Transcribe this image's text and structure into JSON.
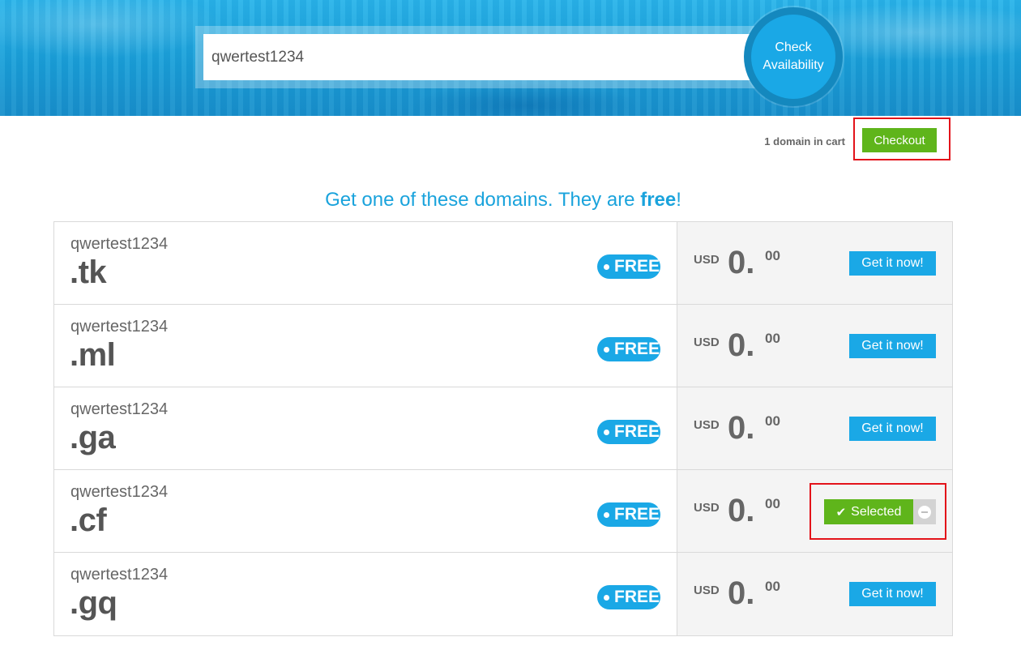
{
  "search": {
    "value": "qwertest1234",
    "button_line1": "Check",
    "button_line2": "Availability"
  },
  "cart": {
    "count_text": "1 domain in cart",
    "checkout_label": "Checkout"
  },
  "heading": {
    "prefix": "Get one of these domains. They are ",
    "emphasis": "free",
    "suffix": "!"
  },
  "domains": [
    {
      "name": "qwertest1234",
      "tld": ".tk",
      "badge": "FREE",
      "currency": "USD",
      "amount": "0.",
      "cents": "00",
      "action": "Get it now!",
      "selected": false
    },
    {
      "name": "qwertest1234",
      "tld": ".ml",
      "badge": "FREE",
      "currency": "USD",
      "amount": "0.",
      "cents": "00",
      "action": "Get it now!",
      "selected": false
    },
    {
      "name": "qwertest1234",
      "tld": ".ga",
      "badge": "FREE",
      "currency": "USD",
      "amount": "0.",
      "cents": "00",
      "action": "Get it now!",
      "selected": false
    },
    {
      "name": "qwertest1234",
      "tld": ".cf",
      "badge": "FREE",
      "currency": "USD",
      "amount": "0.",
      "cents": "00",
      "action": "Selected",
      "selected": true
    },
    {
      "name": "qwertest1234",
      "tld": ".gq",
      "badge": "FREE",
      "currency": "USD",
      "amount": "0.",
      "cents": "00",
      "action": "Get it now!",
      "selected": false
    }
  ],
  "icons": {
    "selected": "check-icon",
    "remove": "minus-circle-icon",
    "badge": "dot-icon"
  },
  "colors": {
    "accent_blue": "#1aa8e6",
    "accent_green": "#5fb51b",
    "highlight_red": "#e3131a"
  }
}
